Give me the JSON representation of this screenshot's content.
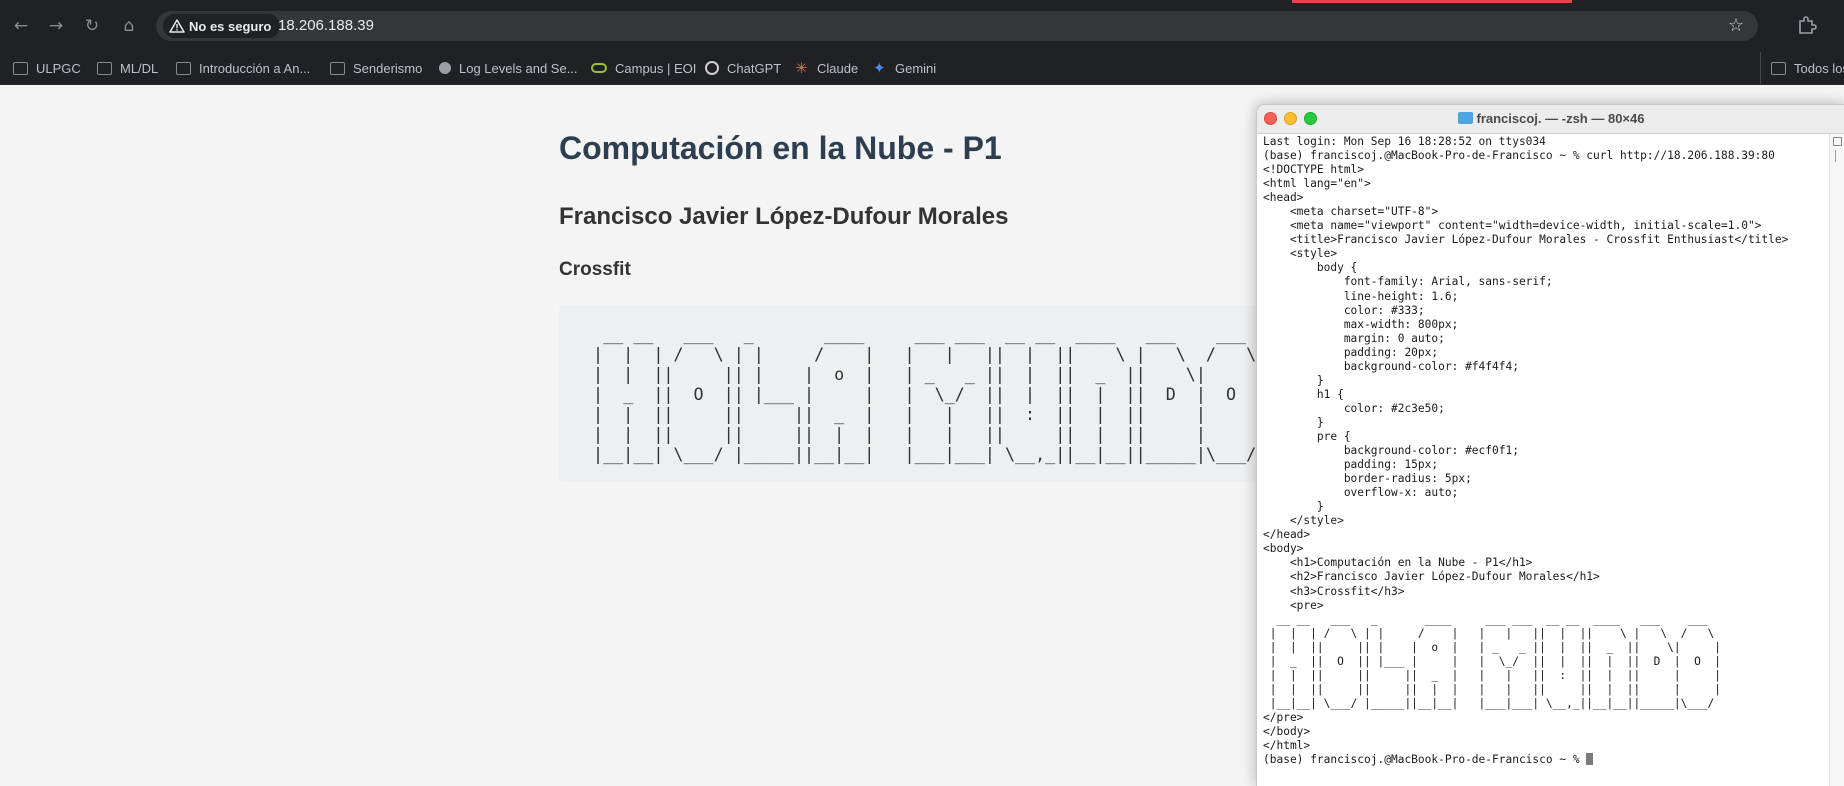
{
  "browser": {
    "nav": {
      "back_icon": "←",
      "forward_icon": "→",
      "reload_icon": "↻",
      "home_icon": "⌂"
    },
    "security_label": "No es seguro",
    "url": "18.206.188.39",
    "star_icon": "☆",
    "bookmarks": [
      {
        "label": "ULPGC",
        "icon": "folder-icon"
      },
      {
        "label": "ML/DL",
        "icon": "folder-icon"
      },
      {
        "label": "Introducción a An...",
        "icon": "folder-icon"
      },
      {
        "label": "Senderismo",
        "icon": "folder-icon"
      },
      {
        "label": "Log Levels and Se...",
        "icon": "site-icon"
      },
      {
        "label": "Campus | EOI",
        "icon": "eoi-icon"
      },
      {
        "label": "ChatGPT",
        "icon": "chatgpt-icon"
      },
      {
        "label": "Claude",
        "icon": "claude-icon"
      },
      {
        "label": "Gemini",
        "icon": "gemini-icon"
      },
      {
        "label": "Todos los m",
        "icon": "folder-icon"
      }
    ]
  },
  "page": {
    "h1": "Computación en la Nube - P1",
    "h2": "Francisco Javier López-Dufour Morales",
    "h3": "Crossfit",
    "ascii_art": "  __ __   ___   _       ____     ___ ___  __ __  ____   ___    ___ \n |  |  | /   \\ | |     /    |   |   |   ||  |  ||    \\ |   \\  /   \\\n |  |  ||     || |    |  o  |   | _   _ ||  |  ||  _  ||    \\|     |\n |  _  ||  O  || |___ |     |   |  \\_/  ||  |  ||  |  ||  D  |  O  |\n |  |  ||     ||     ||  _  |   |   |   ||  :  ||  |  ||     |     |\n |  |  ||     ||     ||  |  |   |   |   ||     ||  |  ||     |     |\n |__|__| \\___/ |_____||__|__|   |___|___| \\__,_||__|__||_____|\\___/ "
  },
  "terminal": {
    "title": "franciscoj. — -zsh — 80×46",
    "content": "Last login: Mon Sep 16 18:28:52 on ttys034\n(base) franciscoj.@MacBook-Pro-de-Francisco ~ % curl http://18.206.188.39:80\n<!DOCTYPE html>\n<html lang=\"en\">\n<head>\n    <meta charset=\"UTF-8\">\n    <meta name=\"viewport\" content=\"width=device-width, initial-scale=1.0\">\n    <title>Francisco Javier López-Dufour Morales - Crossfit Enthusiast</title>\n    <style>\n        body {\n            font-family: Arial, sans-serif;\n            line-height: 1.6;\n            color: #333;\n            max-width: 800px;\n            margin: 0 auto;\n            padding: 20px;\n            background-color: #f4f4f4;\n        }\n        h1 {\n            color: #2c3e50;\n        }\n        pre {\n            background-color: #ecf0f1;\n            padding: 15px;\n            border-radius: 5px;\n            overflow-x: auto;\n        }\n    </style>\n</head>\n<body>\n    <h1>Computación en la Nube - P1</h1>\n    <h2>Francisco Javier López-Dufour Morales</h1>\n    <h3>Crossfit</h3>\n    <pre>\n  __ __   ___   _       ____     ___ ___  __ __  ____   ___    ___ \n |  |  | /   \\ | |     /    |   |   |   ||  |  ||    \\ |   \\  /   \\\n |  |  ||     || |    |  o  |   | _   _ ||  |  ||  _  ||    \\|     |\n |  _  ||  O  || |___ |     |   |  \\_/  ||  |  ||  |  ||  D  |  O  |\n |  |  ||     ||     ||  _  |   |   |   ||  :  ||  |  ||     |     |\n |  |  ||     ||     ||  |  |   |   |   ||     ||  |  ||     |     |\n |__|__| \\___/ |_____||__|__|   |___|___| \\__,_||__|__||_____|\\___/ \n</pre>\n</body>\n</html>",
    "prompt": "(base) franciscoj.@MacBook-Pro-de-Francisco ~ % "
  }
}
